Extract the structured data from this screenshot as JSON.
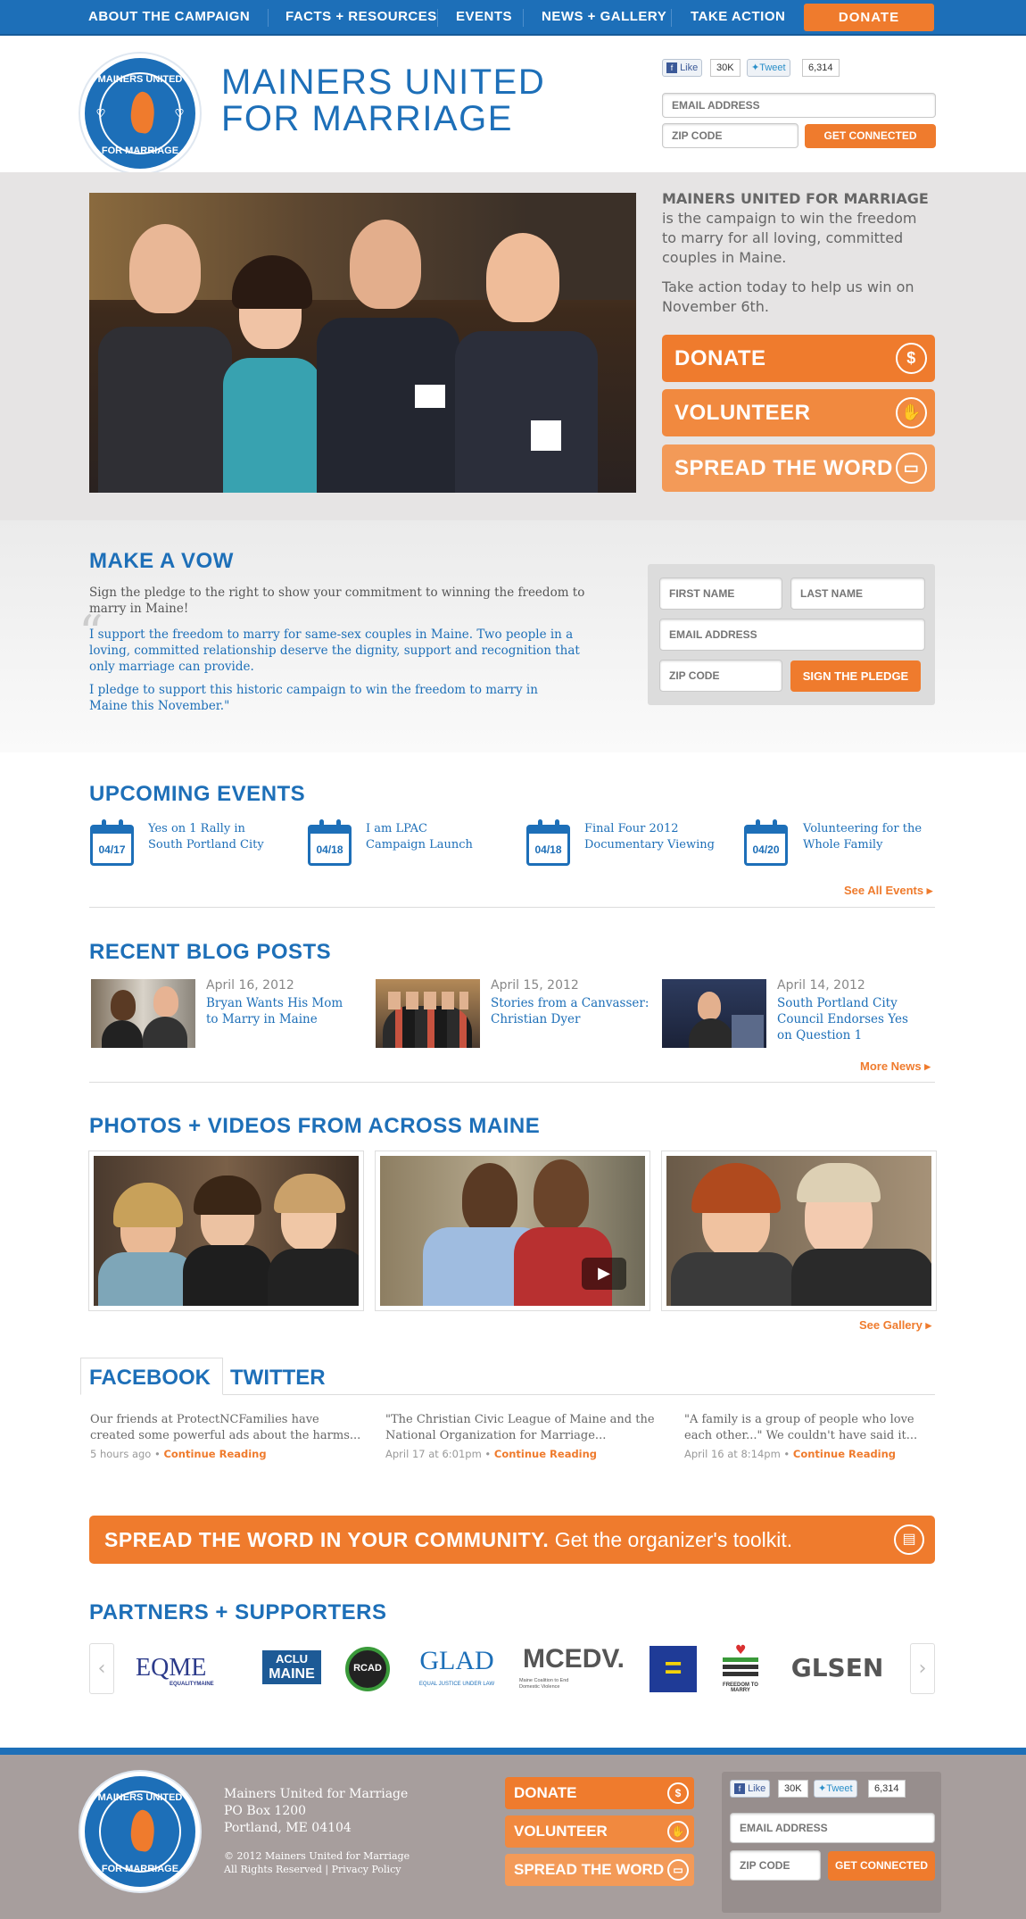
{
  "nav": {
    "items": [
      "ABOUT THE CAMPAIGN",
      "FACTS + RESOURCES",
      "EVENTS",
      "NEWS + GALLERY",
      "TAKE ACTION"
    ],
    "donate": "DONATE"
  },
  "header": {
    "title_line1": "MAINERS UNITED",
    "title_line2": "FOR MARRIAGE",
    "logo_top": "MAINERS UNITED",
    "logo_bottom": "FOR MARRIAGE",
    "fb_like": "Like",
    "fb_count": "30K",
    "tweet": "Tweet",
    "tweet_count": "6,314",
    "email_placeholder": "EMAIL ADDRESS",
    "zip_placeholder": "ZIP CODE",
    "connect_button": "GET CONNECTED"
  },
  "hero": {
    "heading": "MAINERS UNITED FOR MARRIAGE",
    "text1": "is the campaign to win the freedom to marry for all loving, committed couples in Maine.",
    "text2": "Take action today to help us win on November 6th.",
    "donate": "DONATE",
    "volunteer": "VOLUNTEER",
    "spread": "SPREAD THE WORD"
  },
  "vow": {
    "heading": "MAKE A VOW",
    "intro": "Sign the pledge to the right to show your commitment to winning the freedom to marry in Maine!",
    "quote1": "I support the freedom to marry for same-sex couples in Maine. Two people in a loving, committed relationship deserve the dignity, support and recognition that only marriage can provide.",
    "quote2": "I pledge to support this historic campaign to win the freedom to marry in Maine this November.\"",
    "first_name": "FIRST NAME",
    "last_name": "LAST NAME",
    "email": "EMAIL ADDRESS",
    "zip": "ZIP CODE",
    "sign_button": "SIGN THE PLEDGE"
  },
  "events": {
    "heading": "UPCOMING EVENTS",
    "items": [
      {
        "date": "04/17",
        "title1": "Yes on 1 Rally in",
        "title2": "South Portland City"
      },
      {
        "date": "04/18",
        "title1": "I am LPAC",
        "title2": "Campaign Launch"
      },
      {
        "date": "04/18",
        "title1": "Final Four 2012",
        "title2": "Documentary Viewing"
      },
      {
        "date": "04/20",
        "title1": "Volunteering for the",
        "title2": "Whole Family"
      }
    ],
    "see_all": "See All Events"
  },
  "blog": {
    "heading": "RECENT BLOG POSTS",
    "posts": [
      {
        "date": "April 16, 2012",
        "title": "Bryan Wants His Mom to Marry in Maine"
      },
      {
        "date": "April 15, 2012",
        "title": "Stories from a Canvasser: Christian Dyer"
      },
      {
        "date": "April 14, 2012",
        "title": "South Portland City Council Endorses Yes on Question 1"
      }
    ],
    "more": "More News"
  },
  "gallery": {
    "heading": "PHOTOS + VIDEOS FROM ACROSS MAINE",
    "see": "See Gallery"
  },
  "social_feed": {
    "tab_facebook": "FACEBOOK",
    "tab_twitter": "TWITTER",
    "items": [
      {
        "text": "Our friends at ProtectNCFamilies have created some powerful ads about the harms...",
        "time": "5 hours ago",
        "link": "Continue Reading"
      },
      {
        "text": "\"The Christian Civic League of Maine and the National Organization for Marriage...",
        "time": "April 17 at 6:01pm",
        "link": "Continue Reading"
      },
      {
        "text": "\"A family is a group of people who love each other...\" We couldn't have said it...",
        "time": "April 16 at 8:14pm",
        "link": "Continue Reading"
      }
    ]
  },
  "banner": {
    "bold": "SPREAD THE WORD IN YOUR COMMUNITY.",
    "rest": "Get the organizer's toolkit."
  },
  "partners": {
    "heading": "PARTNERS + SUPPORTERS",
    "logos": [
      "EQME",
      "EQUALITYMAINE",
      "ACLU",
      "MAINE",
      "RCAD",
      "GLAD",
      "EQUAL JUSTICE UNDER LAW",
      "MCEDV.",
      "Maine Coalition to End Domestic Violence",
      "=",
      "FREEDOM TO MARRY",
      "GLSEN"
    ]
  },
  "footer": {
    "org": "Mainers United for Marriage",
    "address1": "PO Box 1200",
    "address2": "Portland, ME 04104",
    "copyright": "© 2012 Mainers United for Marriage",
    "rights": "All Rights Reserved",
    "privacy": "Privacy Policy",
    "donate": "DONATE",
    "volunteer": "VOLUNTEER",
    "spread": "SPREAD THE WORD",
    "fb_like": "Like",
    "fb_count": "30K",
    "tweet": "Tweet",
    "tweet_count": "6,314",
    "email": "EMAIL ADDRESS",
    "zip": "ZIP CODE",
    "connect": "GET CONNECTED"
  },
  "colors": {
    "brand_blue": "#1d6fb8",
    "accent_orange": "#ef7b2d",
    "footer": "#a79e9d"
  }
}
